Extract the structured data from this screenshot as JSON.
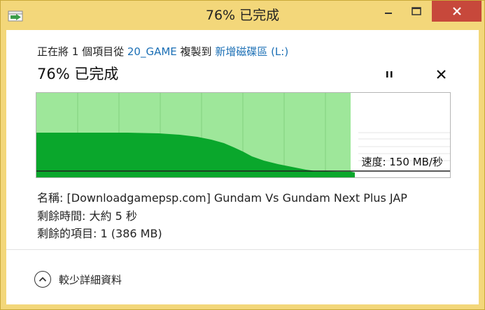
{
  "window": {
    "title": "76% 已完成"
  },
  "copy": {
    "desc_prefix": "正在將 1 個項目從 ",
    "source": "20_GAME",
    "desc_middle": " 複製到 ",
    "destination": "新增磁碟區 (L:)",
    "status": "76% 已完成",
    "progress_fraction": 0.76,
    "speed_label": "速度: 150 MB/秒"
  },
  "info": {
    "name_label": "名稱:",
    "name_value": "[Downloadgamepsp.com] Gundam Vs Gundam Next Plus JAP",
    "time_label": "剩餘時間:",
    "time_value": "大約 5 秒",
    "items_label": "剩餘的項目:",
    "items_value": "1 (386 MB)"
  },
  "details_toggle": {
    "label": "較少詳細資料"
  },
  "colors": {
    "titlebar": "#f3d77a",
    "progress_fill": "#9ee79a",
    "speed_fill": "#0aa72c",
    "close_button": "#c7483b",
    "link": "#1b6fb5"
  }
}
